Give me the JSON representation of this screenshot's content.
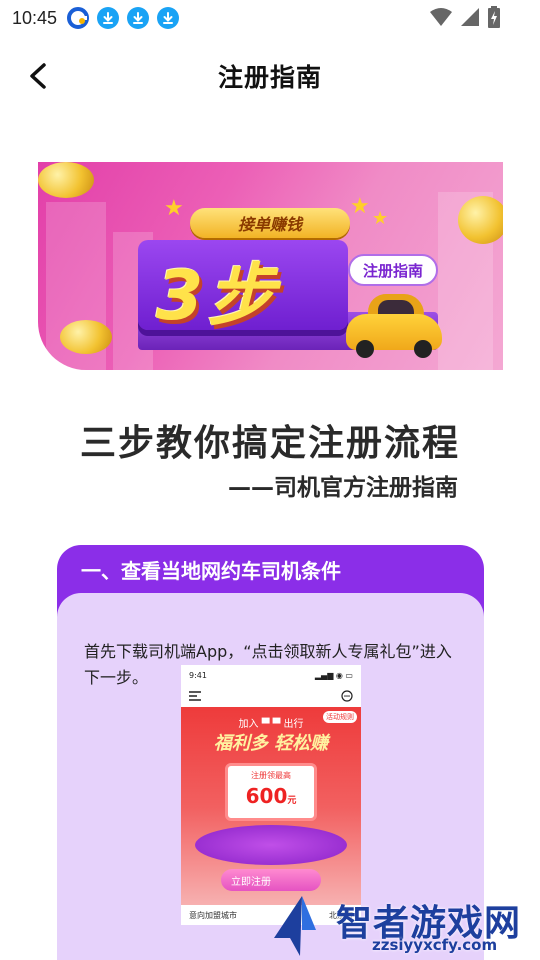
{
  "status_bar": {
    "time": "10:45",
    "icons": [
      "app-icon",
      "download-icon",
      "download-icon",
      "download-icon"
    ],
    "right_icons": [
      "wifi-icon",
      "signal-icon",
      "battery-charging-icon"
    ]
  },
  "header": {
    "title": "注册指南",
    "back_icon": "chevron-left-icon"
  },
  "banner": {
    "ribbon": "接单赚钱",
    "big_text": "3步",
    "badge": "注册指南"
  },
  "headline": "三步教你搞定注册流程",
  "subline": "——司机官方注册指南",
  "step1": {
    "title": "一、查看当地网约车司机条件",
    "desc": "首先下载司机端App，“点击领取新人专属礼包”进入下一步。",
    "phone": {
      "time": "9:41",
      "join": "加入 ▀ ▀ 出行",
      "tag": "活动规则",
      "slogan": "福利多 轻松赚",
      "card_label": "注册领最高",
      "card_amount": "600",
      "card_unit": "元",
      "cta": "立即注册",
      "footer_left": "意向加盟城市",
      "footer_right": "北京市"
    }
  },
  "watermark": {
    "text": "智者游戏网",
    "url": "zzsiyyxcfy.com"
  },
  "colors": {
    "accent_purple": "#8b2ee8",
    "card_bg": "#e6d2fb",
    "banner_pink": "#e23fa9",
    "download_blue": "#1aa3f5"
  }
}
